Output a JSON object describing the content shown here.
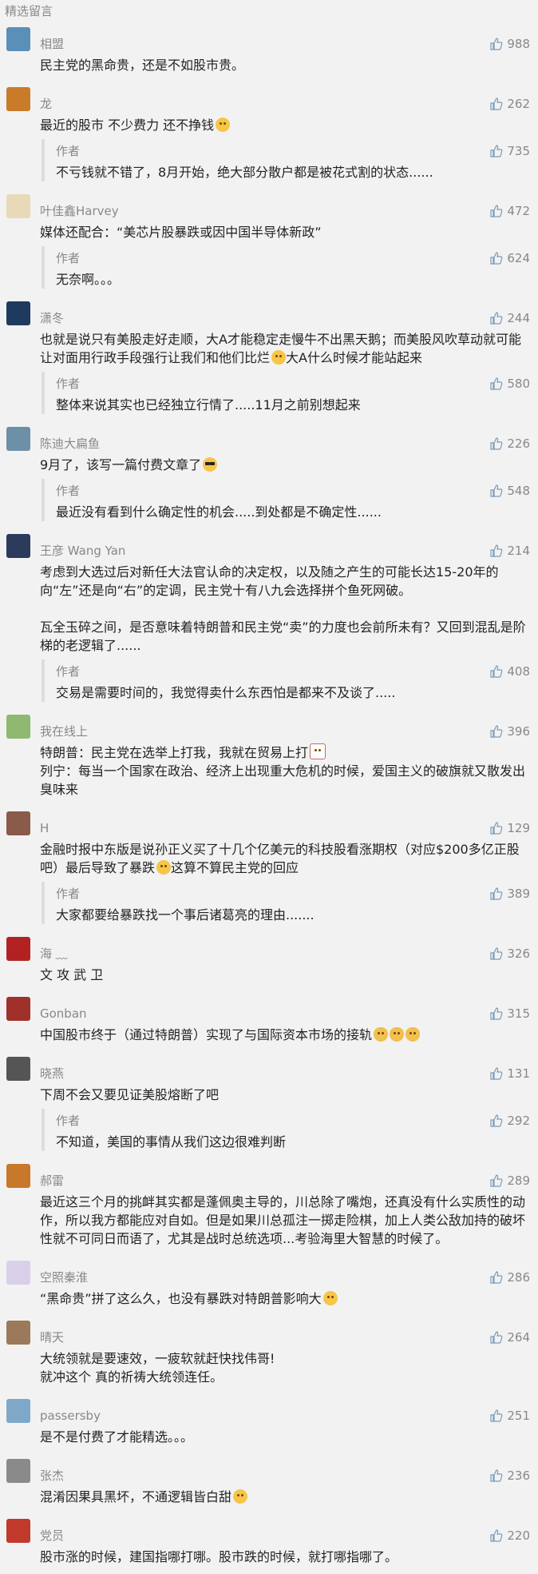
{
  "header": {
    "title": "精选留言"
  },
  "comments": [
    {
      "name": "相盟",
      "likes": "988",
      "text": "民主党的黑命贵，还是不如股市贵。",
      "reply": null,
      "avatar_color": "#5a8fb8"
    },
    {
      "name": "龙",
      "likes": "262",
      "text": "最近的股市 不少费力 还不挣钱",
      "emoji": "emoji",
      "reply": {
        "author": "作者",
        "likes": "735",
        "text": "不亏钱就不错了，8月开始，绝大部分散户都是被花式割的状态......"
      },
      "avatar_color": "#c97b2a"
    },
    {
      "name": "叶佳鑫Harvey",
      "likes": "472",
      "text": "媒体还配合：“美芯片股暴跌或因中国半导体新政”",
      "reply": {
        "author": "作者",
        "likes": "624",
        "text": "无奈啊。。。"
      },
      "avatar_color": "#e8d9b8"
    },
    {
      "name": "潇冬",
      "likes": "244",
      "text": "也就是说只有美股走好走顺，大A才能稳定走慢牛不出黑天鹅；而美股风吹草动就可能让对面用行政手段强行让我们和他们比烂",
      "text_after": "大A什么时候才能站起来",
      "emoji": "emoji",
      "reply": {
        "author": "作者",
        "likes": "580",
        "text": "整体来说其实也已经独立行情了.....11月之前别想起来"
      },
      "avatar_color": "#1e3a5f"
    },
    {
      "name": "陈迪大扁鱼",
      "likes": "226",
      "text": "9月了，该写一篇付费文章了",
      "emoji": "emoji-cool",
      "reply": {
        "author": "作者",
        "likes": "548",
        "text": "最近没有看到什么确定性的机会.....到处都是不确定性......"
      },
      "avatar_color": "#6d8fa8"
    },
    {
      "name": "王彦 Wang Yan",
      "likes": "214",
      "text": "考虑到大选过后对新任大法官认命的决定权，以及随之产生的可能长达15-20年的向“左”还是向“右”的定调，民主党十有八九会选择拼个鱼死网破。\n\n瓦全玉碎之间，是否意味着特朗普和民主党“卖”的力度也会前所未有？又回到混乱是阶梯的老逻辑了......",
      "reply": {
        "author": "作者",
        "likes": "408",
        "text": "交易是需要时间的，我觉得卖什么东西怕是都来不及谈了....."
      },
      "avatar_color": "#2b3b5c"
    },
    {
      "name": "我在线上",
      "likes": "396",
      "text": "特朗普：民主党在选举上打我，我就在贸易上打",
      "emoji": "emoji-bull",
      "text_extra": "列宁：每当一个国家在政治、经济上出现重大危机的时候，爱国主义的破旗就又散发出臭味来",
      "reply": null,
      "avatar_color": "#8fb870"
    },
    {
      "name": "H",
      "likes": "129",
      "text": "金融时报中东版是说孙正义买了十几个亿美元的科技股看涨期权（对应$200多亿正股吧）最后导致了暴跌",
      "text_after": "这算不算民主党的回应",
      "emoji": "emoji",
      "reply": {
        "author": "作者",
        "likes": "389",
        "text": "大家都要给暴跌找一个事后诸葛亮的理由......."
      },
      "avatar_color": "#8a5a4a"
    },
    {
      "name": "海 ﹏",
      "likes": "326",
      "text": "文 攻 武 卫",
      "reply": null,
      "avatar_color": "#b22222"
    },
    {
      "name": "Gonban",
      "likes": "315",
      "text": "中国股市终于（通过特朗普）实现了与国际资本市场的接轨",
      "emoji": "emoji-cat",
      "emoji_count": 3,
      "reply": null,
      "avatar_color": "#a0302a"
    },
    {
      "name": "晓燕",
      "likes": "131",
      "text": "下周不会又要见证美股熔断了吧",
      "reply": {
        "author": "作者",
        "likes": "292",
        "text": "不知道，美国的事情从我们这边很难判断"
      },
      "avatar_color": "#555555"
    },
    {
      "name": "郝雷",
      "likes": "289",
      "text": "最近这三个月的挑衅其实都是蓬佩奥主导的，川总除了嘴炮，还真没有什么实质性的动作，所以我方都能应对自如。但是如果川总孤注一掷走险棋，加上人类公敌加持的破坏性就不可同日而语了，尤其是战时总统选项...考验海里大智慧的时候了。",
      "reply": null,
      "avatar_color": "#c8782a"
    },
    {
      "name": "空照秦淮",
      "likes": "286",
      "text": "“黑命贵”拼了这么久，也没有暴跌对特朗普影响大",
      "emoji": "emoji",
      "reply": null,
      "avatar_color": "#d8d0e8"
    },
    {
      "name": "晴天",
      "likes": "264",
      "text": "大统领就是要速效，一疲软就赶快找伟哥!\n就冲这个 真的祈祷大统领连任。",
      "reply": null,
      "avatar_color": "#9a7a5a"
    },
    {
      "name": "passersby",
      "likes": "251",
      "text": "是不是付费了才能精选。。。",
      "reply": null,
      "avatar_color": "#7fa8c8"
    },
    {
      "name": "张杰",
      "likes": "236",
      "text": "混淆因果具黑坏，不通逻辑皆白甜",
      "emoji": "emoji",
      "reply": null,
      "avatar_color": "#8a8a8a"
    },
    {
      "name": "党员",
      "likes": "220",
      "text": "股市涨的时候，建国指哪打哪。股市跌的时候，就打哪指哪了。",
      "reply": null,
      "avatar_color": "#c0392b"
    }
  ]
}
